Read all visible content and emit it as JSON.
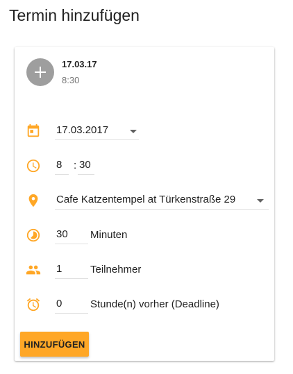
{
  "page": {
    "title": "Termin hinzufügen"
  },
  "summary": {
    "date": "17.03.17",
    "time": "8:30"
  },
  "form": {
    "date": "17.03.2017",
    "hour": "8",
    "time_separator": ":",
    "minute": "30",
    "location": "Cafe Katzentempel at Türkenstraße 29",
    "duration_value": "30",
    "duration_unit": "Minuten",
    "participants_value": "1",
    "participants_label": "Teilnehmer",
    "deadline_value": "0",
    "deadline_label": "Stunde(n) vorher (Deadline)"
  },
  "actions": {
    "submit_label": "HINZUFÜGEN"
  },
  "colors": {
    "accent": "#ffa726",
    "icon": "#ffa726",
    "avatar": "#9e9e9e"
  },
  "icons": [
    "add-icon",
    "calendar-icon",
    "clock-icon",
    "location-pin-icon",
    "timelapse-icon",
    "people-icon",
    "alarm-icon",
    "dropdown-arrow-icon"
  ]
}
